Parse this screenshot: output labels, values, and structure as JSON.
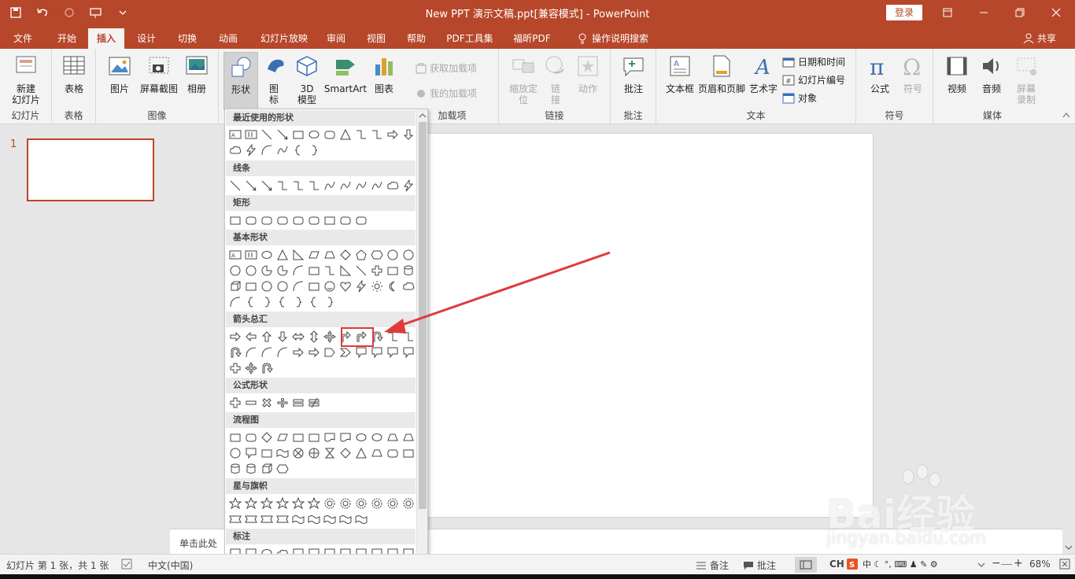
{
  "window": {
    "title": "New PPT 演示文稿.ppt[兼容模式]  -  PowerPoint",
    "login_label": "登录"
  },
  "tabs": {
    "items": [
      "文件",
      "开始",
      "插入",
      "设计",
      "切换",
      "动画",
      "幻灯片放映",
      "审阅",
      "视图",
      "帮助",
      "PDF工具集",
      "福昕PDF"
    ],
    "active": "插入",
    "tell_me": "操作说明搜索",
    "share": "共享"
  },
  "ribbon": {
    "new_slide": "新建\n幻灯片",
    "slides_group": "幻灯片",
    "table": "表格",
    "tables_group": "表格",
    "picture": "图片",
    "screenshot": "屏幕截图",
    "album": "相册",
    "images_group": "图像",
    "shapes": "形状",
    "icons": "图\n标",
    "model3d": "3D\n模型",
    "smartart": "SmartArt",
    "chart": "图表",
    "get_addins": "获取加载项",
    "my_addins": "我的加载项",
    "addins_group": "加载项",
    "zoom": "缩放定\n位",
    "link": "链\n接",
    "action": "动作",
    "links_group": "链接",
    "comment": "批注",
    "comments_group": "批注",
    "textbox": "文本框",
    "header_footer": "页眉和页脚",
    "wordart": "艺术字",
    "datetime": "日期和时间",
    "slide_number": "幻灯片编号",
    "object": "对象",
    "text_group": "文本",
    "equation": "公式",
    "symbol": "符号",
    "symbols_group": "符号",
    "video": "视频",
    "audio": "音频",
    "screen_record": "屏幕\n录制",
    "media_group": "媒体"
  },
  "slides_panel": {
    "slide_number": "1"
  },
  "notes": {
    "placeholder": "单击此处"
  },
  "shapes_gallery": {
    "categories": [
      "最近使用的形状",
      "线条",
      "矩形",
      "基本形状",
      "箭头总汇",
      "公式形状",
      "流程图",
      "星与旗帜",
      "标注"
    ]
  },
  "statusbar": {
    "slide_info": "幻灯片 第 1 张，共 1 张",
    "language": "中文(中国)",
    "notes_btn": "备注",
    "comments_btn": "批注",
    "ime": "CH",
    "zoom": "68%"
  },
  "watermark": {
    "brand": "Bai经验",
    "url": "jingyan.baidu.com"
  },
  "colors": {
    "accent": "#b7472a",
    "highlight": "#e03a3a"
  }
}
